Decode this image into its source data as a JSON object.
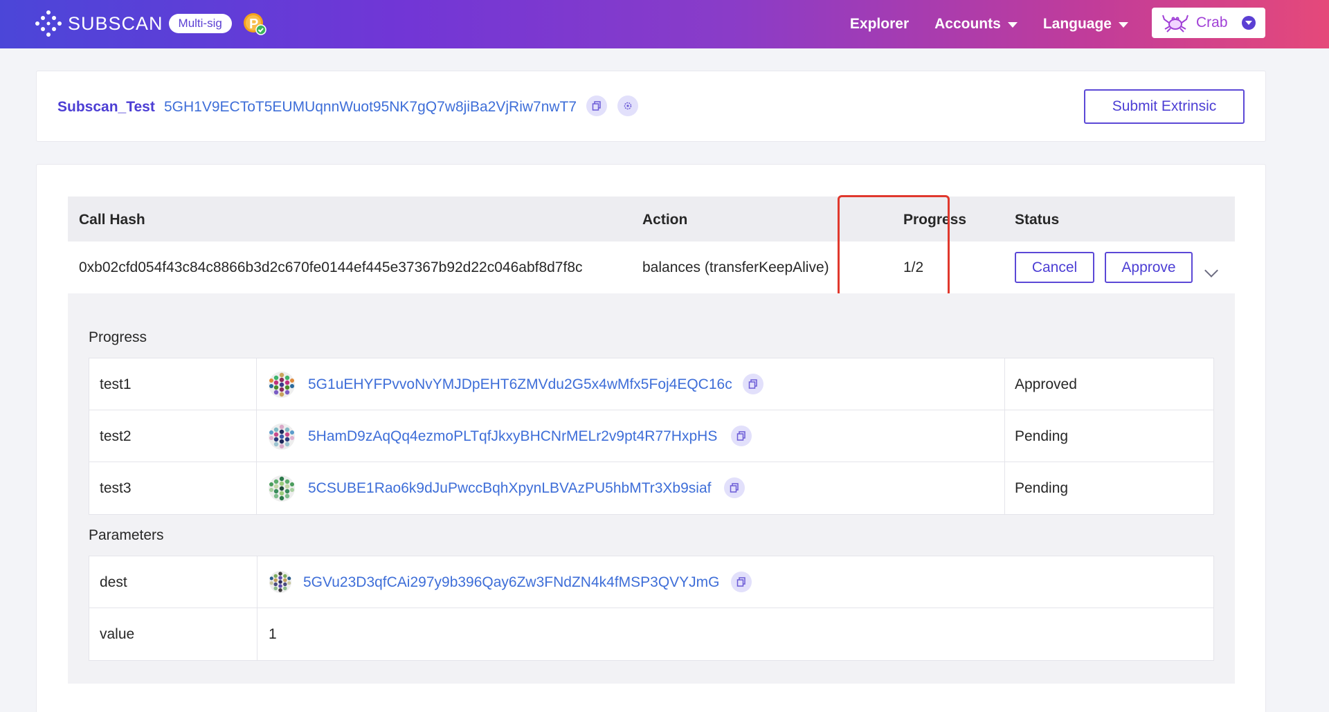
{
  "header": {
    "brand": "SUBSCAN",
    "badge": "Multi-sig",
    "nav": [
      "Explorer",
      "Accounts",
      "Language"
    ],
    "network": "Crab",
    "colors": {
      "gradient_start": "#4b46d8",
      "gradient_end": "#e5497a"
    }
  },
  "account": {
    "name": "Subscan_Test",
    "address": "5GH1V9ECToT5EUMUqnnWuot95NK7gQ7w8jiBa2VjRiw7nwT7",
    "submit_label": "Submit Extrinsic"
  },
  "table": {
    "columns": [
      "Call Hash",
      "Action",
      "Progress",
      "Status"
    ],
    "row": {
      "call_hash": "0xb02cfd054f43c84c8866b3d2c670fe0144ef445e37367b92d22c046abf8d7f8c",
      "action": "balances (transferKeepAlive)",
      "progress": "1/2",
      "cancel_label": "Cancel",
      "approve_label": "Approve"
    }
  },
  "detail": {
    "progress_title": "Progress",
    "signers": [
      {
        "name": "test1",
        "address": "5G1uEHYFPvvoNvYMJDpEHT6ZMVdu2G5x4wMfx5Foj4EQC16c",
        "status": "Approved"
      },
      {
        "name": "test2",
        "address": "5HamD9zAqQq4ezmoPLTqfJkxyBHCNrMELr2v9pt4R77HxpHS",
        "status": "Pending"
      },
      {
        "name": "test3",
        "address": "5CSUBE1Rao6k9dJuPwccBqhXpynLBVAzPU5hbMTr3Xb9siaf",
        "status": "Pending"
      }
    ],
    "parameters_title": "Parameters",
    "params": {
      "dest_label": "dest",
      "dest_value": "5GVu23D3qfCAi297y9b396Qay6Zw3FNdZN4k4fMSP3QVYJmG",
      "value_label": "value",
      "value_value": "1"
    }
  }
}
